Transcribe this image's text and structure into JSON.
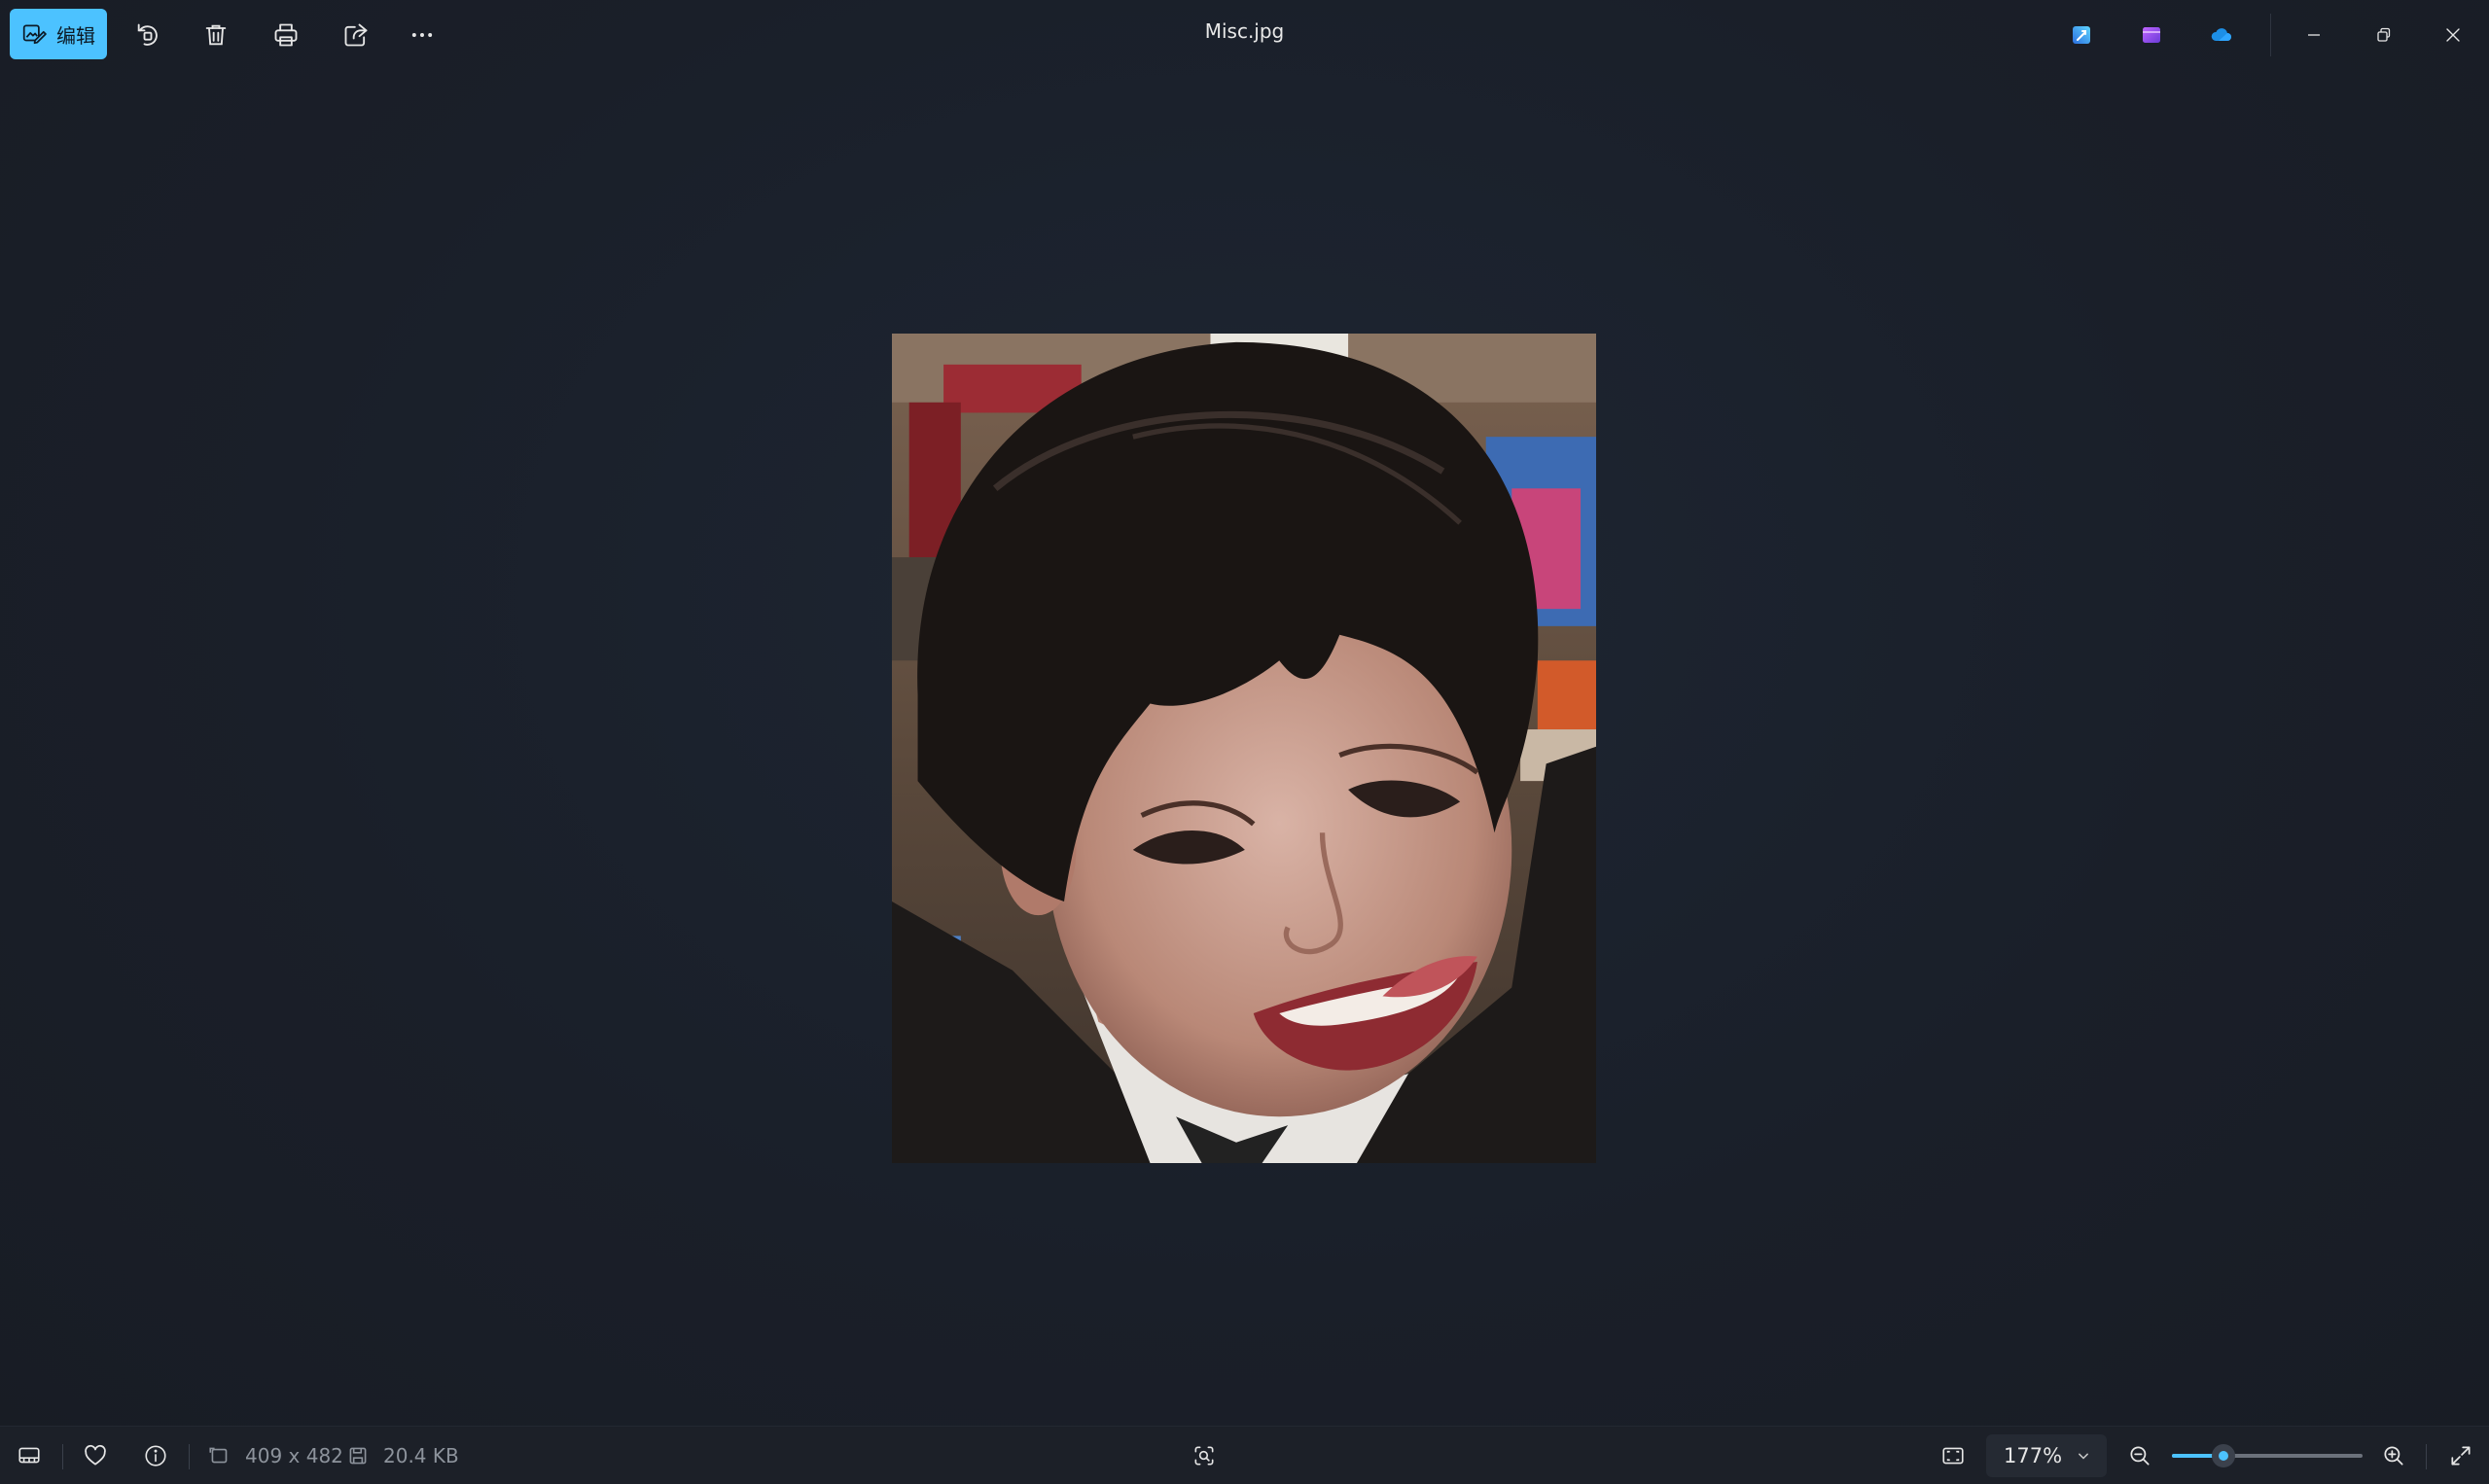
{
  "toolbar": {
    "edit_label": "编辑",
    "icons": [
      "edit-image-icon",
      "rotate-icon",
      "delete-icon",
      "print-icon",
      "share-icon",
      "more-icon"
    ]
  },
  "window": {
    "title": "Misc.jpg",
    "app_icons": [
      "designer-app-icon",
      "clipchamp-app-icon",
      "onedrive-icon"
    ],
    "controls": [
      "minimize-icon",
      "restore-icon",
      "close-icon"
    ]
  },
  "photo": {
    "description_tag": "portrait-photo"
  },
  "status": {
    "dimensions": "409 x 482",
    "file_size": "20.4 KB",
    "zoom_value": "177%",
    "zoom_level": 0.27
  },
  "colors": {
    "accent": "#4cc2ff",
    "background": "#1a1f29",
    "bar": "#1c2028"
  }
}
